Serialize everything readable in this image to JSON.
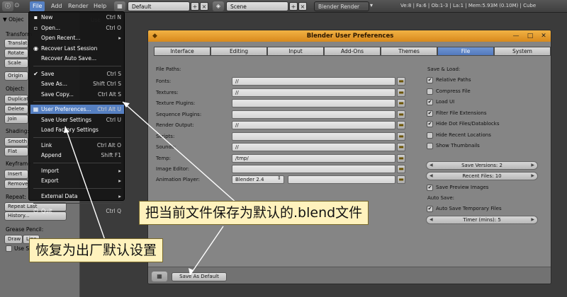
{
  "header": {
    "menus": [
      "File",
      "Add",
      "Render",
      "Help"
    ],
    "screen_layout": "Default",
    "scene": "Scene",
    "render_engine": "Blender Render",
    "stats": "Ve:8 | Fa:6 | Ob:1-3 | La:1 | Mem:5.93M (0.10M) | Cube"
  },
  "tool_panel": {
    "object_tools_header": "▼ Objec",
    "transform_label": "Transform",
    "transform_buttons": [
      "Translate",
      "Rotate",
      "Scale"
    ],
    "origin_button": "Origin",
    "object_label": "Object:",
    "object_buttons": [
      "Duplicate",
      "Delete",
      "Join"
    ],
    "shading_label": "Shading:",
    "shading_buttons": [
      "Smooth",
      "Flat"
    ],
    "keyframes_label": "Keyframe",
    "keyframe_buttons": [
      "Insert",
      "Remove"
    ],
    "repeat_label": "Repeat:",
    "repeat_buttons": [
      "Repeat Last",
      "History..."
    ],
    "grease_label": "Grease Pencil:",
    "grease_buttons": [
      "Draw",
      "Line"
    ],
    "use_sketch": "Use S"
  },
  "file_menu": {
    "items": [
      {
        "icon": "new-file-icon",
        "glyph": "▪",
        "label": "New",
        "shortcut": "Ctrl N"
      },
      {
        "icon": "open-folder-icon",
        "glyph": "▫",
        "label": "Open...",
        "shortcut": "Ctrl O"
      },
      {
        "icon": "",
        "glyph": "",
        "label": "Open Recent...",
        "shortcut": "Shift Ctrl O",
        "submenu": true
      },
      {
        "icon": "recover-icon",
        "glyph": "◉",
        "label": "Recover Last Session",
        "shortcut": ""
      },
      {
        "icon": "",
        "glyph": "",
        "label": "Recover Auto Save...",
        "shortcut": ""
      },
      {
        "separator": true
      },
      {
        "icon": "check-icon",
        "glyph": "✔",
        "label": "Save",
        "shortcut": "Ctrl S"
      },
      {
        "icon": "",
        "glyph": "",
        "label": "Save As...",
        "shortcut": "Shift Ctrl S"
      },
      {
        "icon": "",
        "glyph": "",
        "label": "Save Copy...",
        "shortcut": "Ctrl Alt S"
      },
      {
        "separator": true
      },
      {
        "icon": "preferences-icon",
        "glyph": "▦",
        "label": "User Preferences...",
        "shortcut": "Ctrl Alt U",
        "highlighted": true
      },
      {
        "icon": "",
        "glyph": "",
        "label": "Save User Settings",
        "shortcut": "Ctrl U"
      },
      {
        "icon": "",
        "glyph": "",
        "label": "Load Factory Settings",
        "shortcut": ""
      },
      {
        "separator": true
      },
      {
        "icon": "link-icon",
        "glyph": "",
        "label": "Link",
        "shortcut": "Ctrl Alt O"
      },
      {
        "icon": "",
        "glyph": "",
        "label": "Append",
        "shortcut": "Shift F1"
      },
      {
        "separator": true
      },
      {
        "icon": "",
        "glyph": "",
        "label": "Import",
        "shortcut": "",
        "submenu": true
      },
      {
        "icon": "",
        "glyph": "",
        "label": "Export",
        "shortcut": "",
        "submenu": true
      },
      {
        "separator": true
      },
      {
        "icon": "",
        "glyph": "",
        "label": "External Data",
        "shortcut": "",
        "submenu": true
      },
      {
        "separator": true
      },
      {
        "icon": "power-icon",
        "glyph": "⏻",
        "label": "Quit",
        "shortcut": "Ctrl Q"
      }
    ]
  },
  "prefs": {
    "title": "Blender User Preferences",
    "tabs": [
      "Interface",
      "Editing",
      "Input",
      "Add-Ons",
      "Themes",
      "File",
      "System"
    ],
    "active_tab": "File",
    "file_paths_label": "File Paths:",
    "paths": [
      {
        "label": "Fonts:",
        "value": "//"
      },
      {
        "label": "Textures:",
        "value": "//"
      },
      {
        "label": "Texture Plugins:",
        "value": ""
      },
      {
        "label": "Sequence Plugins:",
        "value": ""
      },
      {
        "label": "Render Output:",
        "value": "//"
      },
      {
        "label": "Scripts:",
        "value": ""
      },
      {
        "label": "Sounds:",
        "value": "//"
      },
      {
        "label": "Temp:",
        "value": "/tmp/"
      },
      {
        "label": "Image Editor:",
        "value": ""
      }
    ],
    "animation_player_label": "Animation Player:",
    "animation_player_value": "Blender 2.4",
    "save_load_label": "Save & Load:",
    "checks": [
      {
        "label": "Relative Paths",
        "checked": true
      },
      {
        "label": "Compress File",
        "checked": false
      },
      {
        "label": "Load UI",
        "checked": true
      },
      {
        "label": "Filter File Extensions",
        "checked": true
      },
      {
        "label": "Hide Dot Files/Datablocks",
        "checked": true
      },
      {
        "label": "Hide Recent Locations",
        "checked": false
      },
      {
        "label": "Show Thumbnails",
        "checked": false
      }
    ],
    "save_versions": "Save Versions: 2",
    "recent_files": "Recent Files: 10",
    "save_preview": {
      "label": "Save Preview Images",
      "checked": true
    },
    "auto_save_label": "Auto Save:",
    "auto_save_temp": {
      "label": "Auto Save Temporary Files",
      "checked": true
    },
    "timer": "Timer (mins): 5",
    "save_as_default": "Save As Default"
  },
  "annotations": {
    "save_default": "把当前文件保存为默认的.blend文件",
    "restore_factory": "恢复为出厂默认设置"
  },
  "colors": {
    "accent": "#5680c2",
    "title_bar": "#e59e2e",
    "callout_bg": "#fff2bd"
  }
}
